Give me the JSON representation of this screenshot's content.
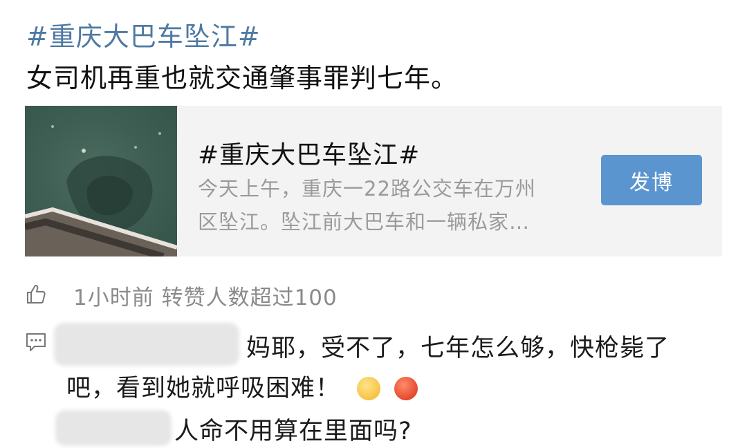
{
  "post": {
    "hashtag": "#重庆大巴车坠江#",
    "text": "女司机再重也就交通肇事罪判七年。"
  },
  "topic_card": {
    "title": "#重庆大巴车坠江#",
    "description_line1": "今天上午，重庆一22路公交车在万州",
    "description_line2": "区坠江。坠江前大巴车和一辆私家…",
    "post_button": "发博"
  },
  "meta": {
    "time_and_reposts": "1小时前 转赞人数超过100",
    "like_icon": "thumbs-up-icon",
    "comment_icon": "comment-icon"
  },
  "comments": [
    {
      "line1": "妈耶，受不了，七年怎么够，快枪毙了",
      "line2": "吧，看到她就呼吸困难！",
      "emojis": [
        "unamused-face-emoji",
        "angry-face-emoji"
      ]
    },
    {
      "line1": "人命不用算在里面吗?"
    }
  ],
  "colors": {
    "hashtag": "#4e79a3",
    "button": "#5b95cf",
    "meta": "#8a8a8a"
  }
}
